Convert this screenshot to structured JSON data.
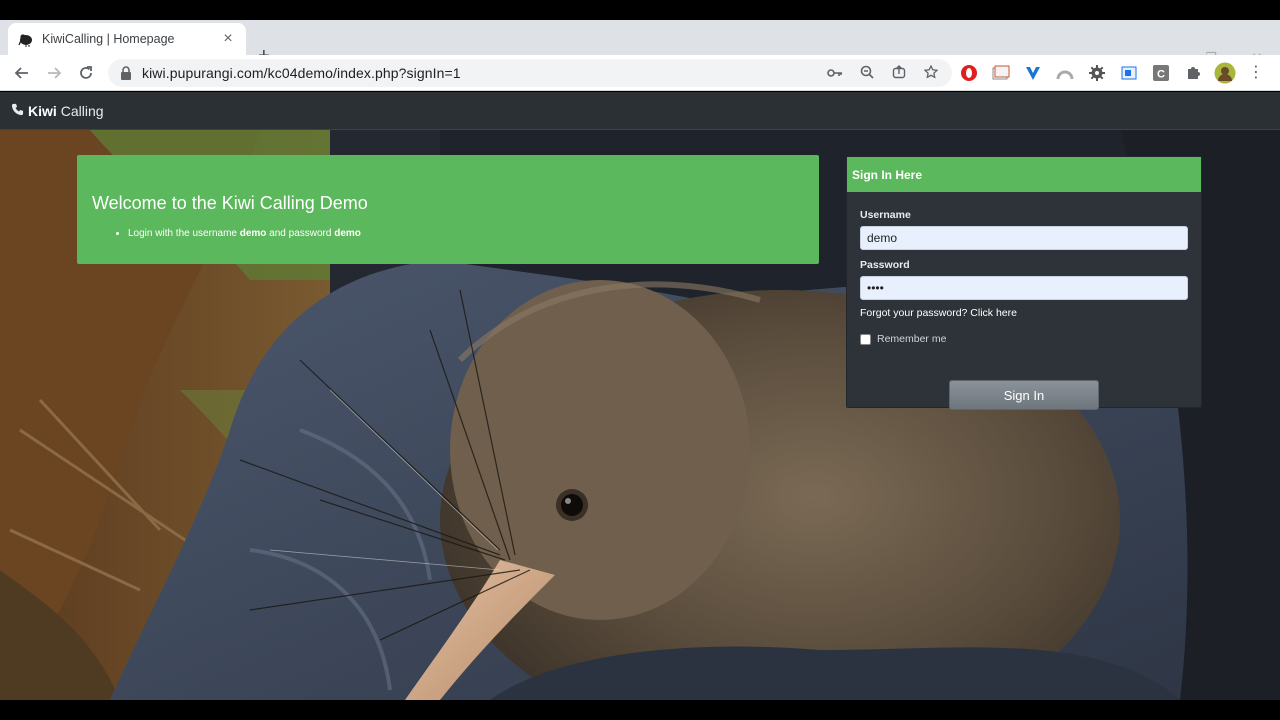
{
  "browser": {
    "tab_title": "KiwiCalling | Homepage",
    "tab_close": "×",
    "new_tab": "+",
    "url": "kiwi.pupurangi.com/kc04demo/index.php?signIn=1",
    "window_controls": [
      "⌄",
      "—",
      "❐",
      "✕"
    ]
  },
  "navbar": {
    "brand_strong": "Kiwi",
    "brand_rest": "Calling",
    "brand_icon": "phone-icon"
  },
  "welcome": {
    "title": "Welcome to the Kiwi Calling Demo",
    "item_prefix": "Login with the username ",
    "username_hint": "demo",
    "item_mid": " and password ",
    "password_hint": "demo"
  },
  "signin": {
    "header": "Sign In Here",
    "username_label": "Username",
    "username_value": "demo",
    "password_label": "Password",
    "password_value": "demo",
    "forgot_text": "Forgot your password? Click here",
    "remember_label": "Remember me",
    "button_label": "Sign In"
  },
  "colors": {
    "accent_green": "#5cb85c",
    "navbar_bg": "#2b3035",
    "panel_bg": "#2d3338"
  }
}
